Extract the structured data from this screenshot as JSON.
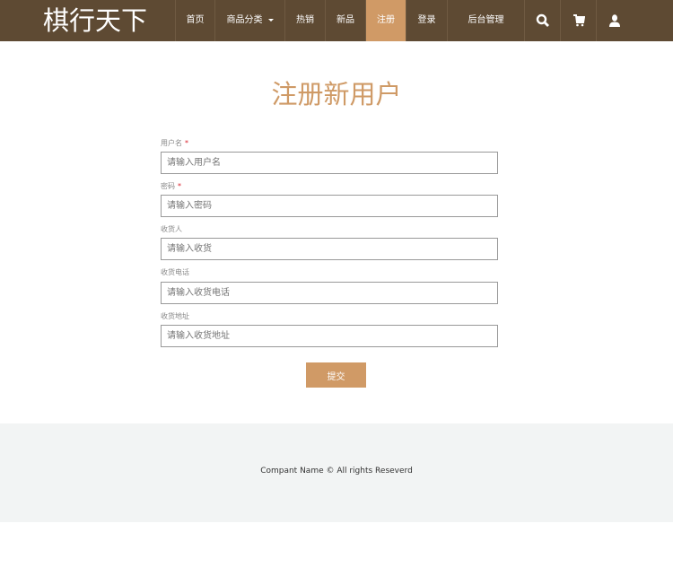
{
  "nav": {
    "logo": "棋行天下",
    "items": [
      "首页",
      "商品分类",
      "热销",
      "新品",
      "注册",
      "登录",
      "后台管理"
    ],
    "active": "注册"
  },
  "title": "注册新用户",
  "form": {
    "fields": [
      {
        "label": "用户名",
        "required": "*",
        "placeholder": "请输入用户名"
      },
      {
        "label": "密码",
        "required": "*",
        "placeholder": "请输入密码"
      },
      {
        "label": "收货人",
        "placeholder": "请输入收货"
      },
      {
        "label": "收货电话",
        "placeholder": "请输入收货电话"
      },
      {
        "label": "收货地址",
        "placeholder": "请输入收货地址"
      }
    ],
    "submit": "提交"
  },
  "footer": {
    "text": "Compant Name © All rights Reseverd"
  },
  "colors": {
    "nav": "#5e4a33",
    "accent": "#d09a66"
  }
}
